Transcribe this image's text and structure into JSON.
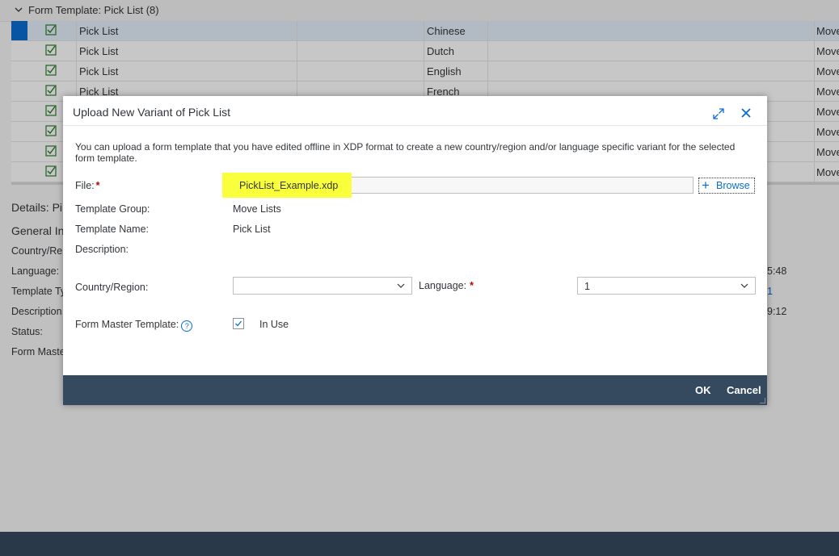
{
  "background": {
    "group_header": "Form Template: Pick List (8)",
    "rows": [
      {
        "name": "Pick List",
        "language": "Chinese",
        "group": "Move"
      },
      {
        "name": "Pick List",
        "language": "Dutch",
        "group": "Move"
      },
      {
        "name": "Pick List",
        "language": "English",
        "group": "Move"
      },
      {
        "name": "Pick List",
        "language": "French",
        "group": "Move"
      },
      {
        "name": "",
        "language": "",
        "group": "Move"
      },
      {
        "name": "",
        "language": "",
        "group": "Move"
      },
      {
        "name": "",
        "language": "",
        "group": "Move"
      },
      {
        "name": "",
        "language": "",
        "group": "Move"
      }
    ],
    "details_title": "Details: Pi",
    "general_title": "General In",
    "detail_labels": [
      "Country/Re",
      "Language:",
      "Template Ty",
      "Description",
      "Status:",
      "Form Maste"
    ],
    "right_values": [
      "5:48",
      "1",
      "9:12"
    ]
  },
  "dialog": {
    "title": "Upload New Variant of Pick List",
    "info": "You can upload a form template that you have edited offline in XDP format to create a new country/region and/or language specific variant for the selected form template.",
    "file_label": "File:",
    "file_value": "PickList_Example.xdp",
    "browse_label": "Browse",
    "template_group_label": "Template Group:",
    "template_group_value": "Move Lists",
    "template_name_label": "Template Name:",
    "template_name_value": "Pick List",
    "description_label": "Description:",
    "country_label": "Country/Region:",
    "country_value": "",
    "language_label": "Language:",
    "language_value": "1",
    "master_label": "Form Master Template:",
    "in_use_label": "In Use",
    "ok_label": "OK",
    "cancel_label": "Cancel",
    "required_mark": "*",
    "help_glyph": "?"
  },
  "colors": {
    "accent": "#0a6ed1",
    "highlight": "#f9ff3a",
    "footer": "#354a5f",
    "required": "#bb0000"
  }
}
